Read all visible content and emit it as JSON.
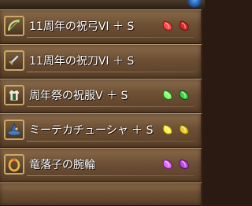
{
  "items": [
    {
      "label": "11周年の祝弓VI ＋ S",
      "icon": "bow-icon",
      "gem_color": "#ff4a4a",
      "gem_dark": "#8a0f14",
      "gems": 2
    },
    {
      "label": "11周年の祝刀VI ＋ S",
      "icon": "sword-icon",
      "gem_color": null,
      "gem_dark": null,
      "gems": 0
    },
    {
      "label": "周年祭の祝服V ＋ S",
      "icon": "armor-icon",
      "gem_color": "#7dff6a",
      "gem_dark": "#1d6a14",
      "gems": 2
    },
    {
      "label": "ミーテカチューシャ ＋ S",
      "icon": "hat-icon",
      "gem_color": "#fff04a",
      "gem_dark": "#8a7a0a",
      "gems": 2
    },
    {
      "label": "竜落子の腕輪",
      "icon": "bracelet-icon",
      "gem_color": "#e26aff",
      "gem_dark": "#6a1a86",
      "gems": 2
    }
  ]
}
